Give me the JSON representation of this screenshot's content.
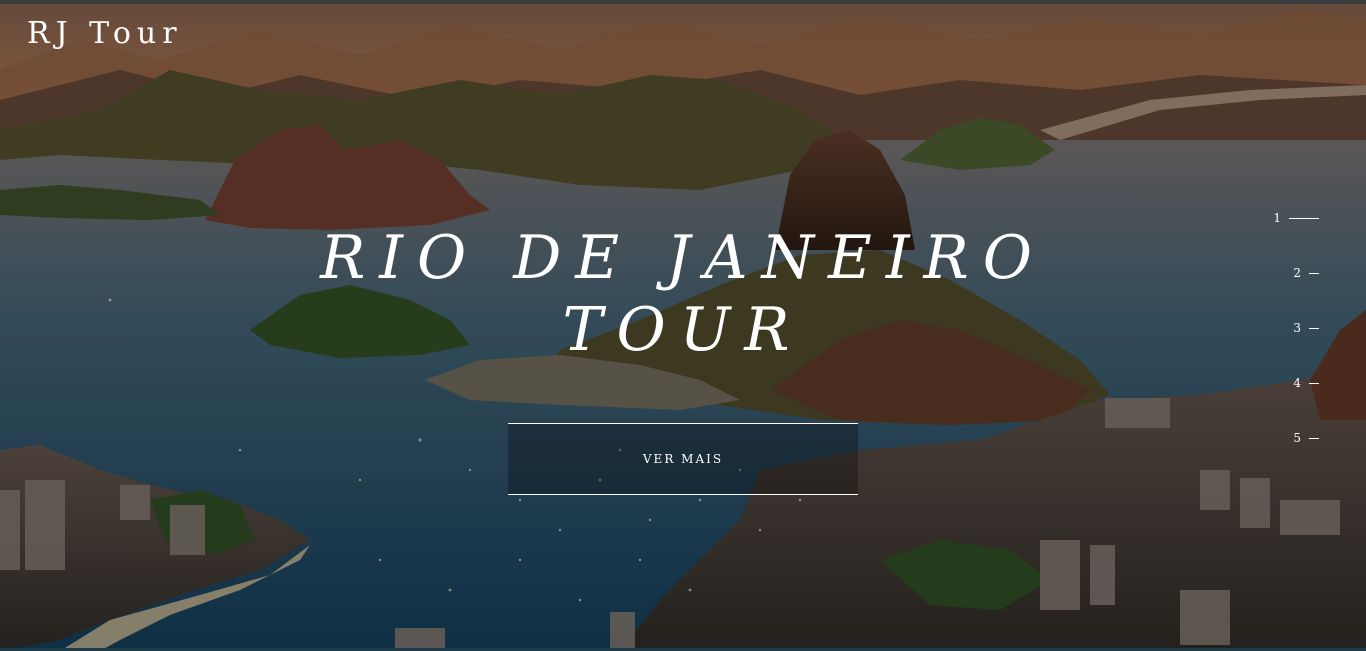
{
  "brand": {
    "name": "RJ Tour"
  },
  "hero": {
    "title_line1": "RIO DE JANEIRO",
    "title_line2": "TOUR",
    "cta_label": "VER MAIS"
  },
  "slides": [
    {
      "label": "1",
      "active": true
    },
    {
      "label": "2",
      "active": false
    },
    {
      "label": "3",
      "active": false
    },
    {
      "label": "4",
      "active": false
    },
    {
      "label": "5",
      "active": false
    }
  ],
  "colors": {
    "text": "#ffffff",
    "water": "#1e4a63",
    "sky": "#b07a55"
  }
}
